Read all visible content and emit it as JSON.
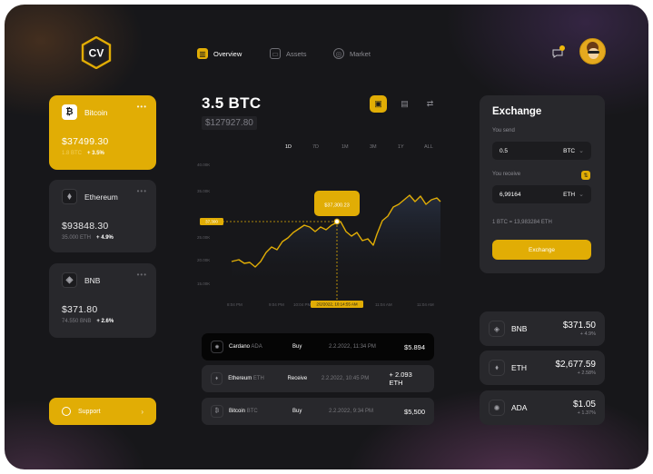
{
  "header": {
    "logo_text": "CV",
    "nav": [
      {
        "label": "Overview",
        "active": true
      },
      {
        "label": "Assets",
        "active": false
      },
      {
        "label": "Market",
        "active": false
      }
    ]
  },
  "wallet_cards": [
    {
      "name": "Bitcoin",
      "amount": "$37499.30",
      "qty": "1.8 BTC",
      "change": "+ 3.5%",
      "active": true,
      "icon": "bitcoin-icon"
    },
    {
      "name": "Ethereum",
      "amount": "$93848.30",
      "qty": "35.000 ETH",
      "change": "+ 4.9%",
      "active": false,
      "icon": "ethereum-icon"
    },
    {
      "name": "BNB",
      "amount": "$371.80",
      "qty": "74.550 BNB",
      "change": "+ 2.6%",
      "active": false,
      "icon": "bnb-icon"
    }
  ],
  "support": {
    "label": "Support"
  },
  "balance": {
    "amount": "3.5 BTC",
    "usd": "$127927.80"
  },
  "ranges": [
    "1D",
    "7D",
    "1M",
    "3M",
    "1Y",
    "ALL"
  ],
  "chart_data": {
    "type": "line",
    "x": [
      "8:04 PM",
      "9:04 PM",
      "10:04 PM",
      "2/2/2022, 10:14:55 AM",
      "11:04 AM",
      "11:04 AM"
    ],
    "y_ticks": [
      "40.00K",
      "35.00K",
      "30.00K",
      "25.00K",
      "20.00K",
      "15.00K"
    ],
    "tooltip_value": "$37,300.23",
    "tooltip_time": "2/2/2022, 10:14:55 AM",
    "y_marker": "37,300"
  },
  "transactions": [
    {
      "coin": "Cardano",
      "ticker": "ADA",
      "type": "Buy",
      "date": "2.2.2022, 11:34 PM",
      "amount": "$5.894",
      "highlight": true
    },
    {
      "coin": "Ethereum",
      "ticker": "ETH",
      "type": "Receive",
      "date": "2.2.2022, 10:45 PM",
      "amount": "+ 2.093 ETH",
      "highlight": false
    },
    {
      "coin": "Bitcoin",
      "ticker": "BTC",
      "type": "Buy",
      "date": "2.2.2022, 9:34 PM",
      "amount": "$5,500",
      "highlight": false
    }
  ],
  "exchange": {
    "title": "Exchange",
    "send_label": "You send",
    "send_value": "0.5",
    "send_currency": "BTC",
    "receive_label": "You receive",
    "receive_value": "6,99164",
    "receive_currency": "ETH",
    "rate": "1 BTC = 13,983284 ETH",
    "button": "Exchange"
  },
  "assets": [
    {
      "name": "BNB",
      "price": "$371.50",
      "change": "+ 4.9%"
    },
    {
      "name": "ETH",
      "price": "$2,677.59",
      "change": "+ 2.58%"
    },
    {
      "name": "ADA",
      "price": "$1.05",
      "change": "+ 1.37%"
    }
  ],
  "colors": {
    "accent": "#e1ad05",
    "panel": "#28282c",
    "background": "#17171a"
  }
}
